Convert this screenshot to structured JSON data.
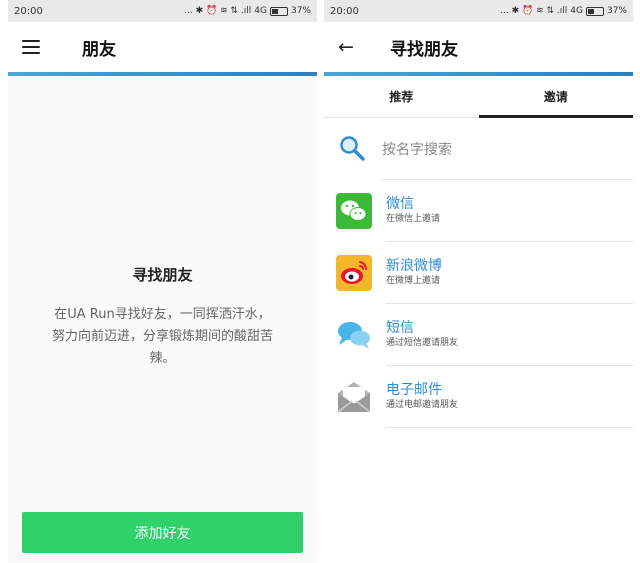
{
  "left": {
    "status": {
      "time": "20:00",
      "icons": "... ✱ ⏰ ≋ ⇅ .ıll",
      "network": "4G",
      "battery": "37%"
    },
    "appbar": {
      "title": "朋友"
    },
    "empty": {
      "title": "寻找朋友",
      "description": "在UA Run寻找好友，一同挥洒汗水，努力向前迈进，分享锻炼期间的酸甜苦辣。"
    },
    "add_button": "添加好友"
  },
  "right": {
    "status": {
      "time": "20:00",
      "icons": "... ✱ ⏰ ≋ ⇅ .ıll",
      "network": "4G",
      "battery": "37%"
    },
    "appbar": {
      "title": "寻找朋友"
    },
    "tabs": [
      {
        "label": "推荐",
        "active": false
      },
      {
        "label": "邀请",
        "active": true
      }
    ],
    "search": {
      "placeholder": "按名字搜索"
    },
    "share_options": [
      {
        "name": "微信",
        "sub": "在微信上邀请",
        "icon": "wechat-icon",
        "color": "#3db93a"
      },
      {
        "name": "新浪微博",
        "sub": "在微博上邀请",
        "icon": "weibo-icon",
        "color": "#f6b62c"
      },
      {
        "name": "短信",
        "sub": "通过短信邀请朋友",
        "icon": "sms-icon",
        "color": "#4ab4e8"
      },
      {
        "name": "电子邮件",
        "sub": "通过电邮邀请朋友",
        "icon": "email-icon",
        "color": "#999999"
      }
    ]
  },
  "colors": {
    "accent_line": "#3f93cc",
    "primary_button": "#30d06a",
    "link_text": "#2e8ecf"
  },
  "battery_level": 0.37
}
